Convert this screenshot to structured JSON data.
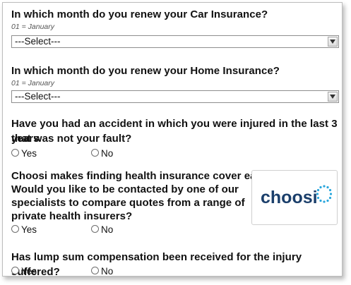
{
  "q1": {
    "question": "In which month do you renew your Car Insurance?",
    "hint": "01 = January",
    "select_value": "---Select---"
  },
  "q2": {
    "question": "In which month do you renew your Home Insurance?",
    "hint": "01 = January",
    "select_value": "---Select---"
  },
  "q3": {
    "question_line1": "Have you had an accident in which you were injured in the last 3 years",
    "question_line2": "that was not your fault?",
    "yes": "Yes",
    "no": "No"
  },
  "q4": {
    "line1": "Choosi makes finding health insurance cover easy!",
    "line2": "Would you like to be contacted by one of our",
    "line3": "specialists to compare quotes from a range of",
    "line4": "private health insurers?",
    "yes": "Yes",
    "no": "No",
    "logo_text": "choosi",
    "logo_color": "#1b3f6b"
  },
  "q5": {
    "question": "Has lump sum compensation been received for the injury suffered?",
    "yes": "Yes",
    "no": "No"
  },
  "icons": {
    "select_arrow": "chevron-down-icon",
    "radio": "radio-unchecked-icon"
  }
}
